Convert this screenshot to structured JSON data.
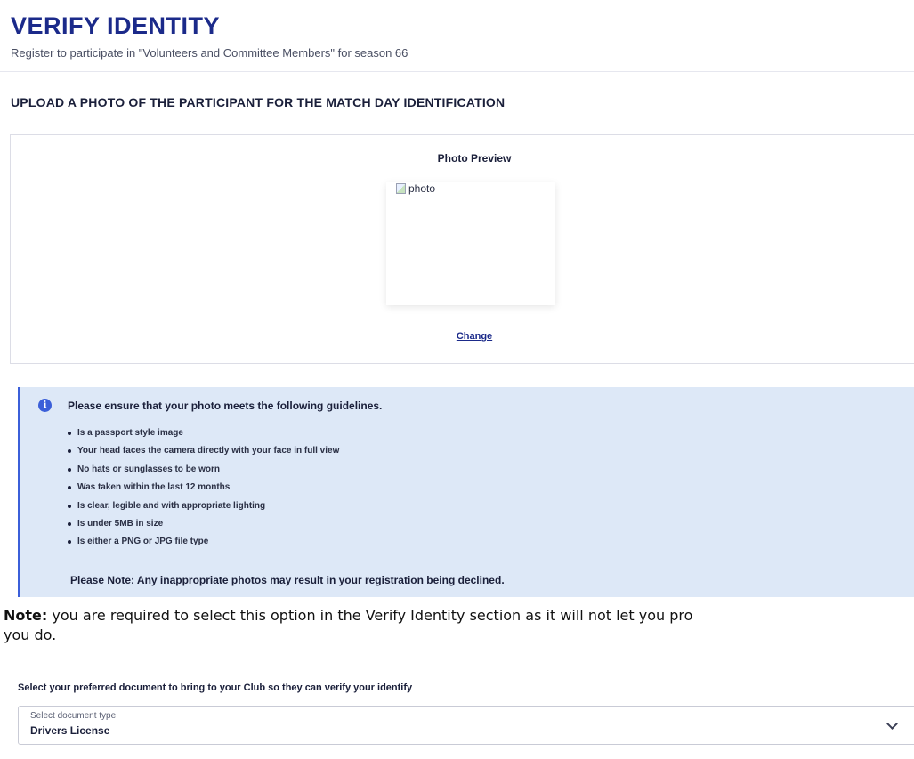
{
  "header": {
    "title": "VERIFY IDENTITY",
    "subtitle": "Register to participate in \"Volunteers and Committee Members\" for season 66"
  },
  "upload_section": {
    "heading": "UPLOAD A PHOTO OF THE PARTICIPANT FOR THE MATCH DAY IDENTIFICATION",
    "preview_title": "Photo Preview",
    "photo_alt": "photo",
    "change_label": "Change"
  },
  "guidelines": {
    "intro": "Please ensure that your photo meets the following guidelines.",
    "items": [
      "Is a passport style image",
      "Your head faces the camera directly with your face in full view",
      "No hats or sunglasses to be worn",
      "Was taken within the last 12 months",
      "Is clear, legible and with appropriate lighting",
      "Is under 5MB in size",
      "Is either a PNG or JPG file type"
    ],
    "note": "Please Note: Any inappropriate photos may result in your registration being declined."
  },
  "note": {
    "label": "Note:",
    "line1": " you are required to select this option in the Verify Identity section as it will not let you pro",
    "line2": "you do."
  },
  "document": {
    "prompt": "Select your preferred document to bring to your Club so they can verify your identify",
    "select_label": "Select document type",
    "select_value": "Drivers License"
  },
  "colors": {
    "title": "#1b2a8a",
    "info_box": "#dde8f7",
    "accent": "#3b5fd9"
  }
}
